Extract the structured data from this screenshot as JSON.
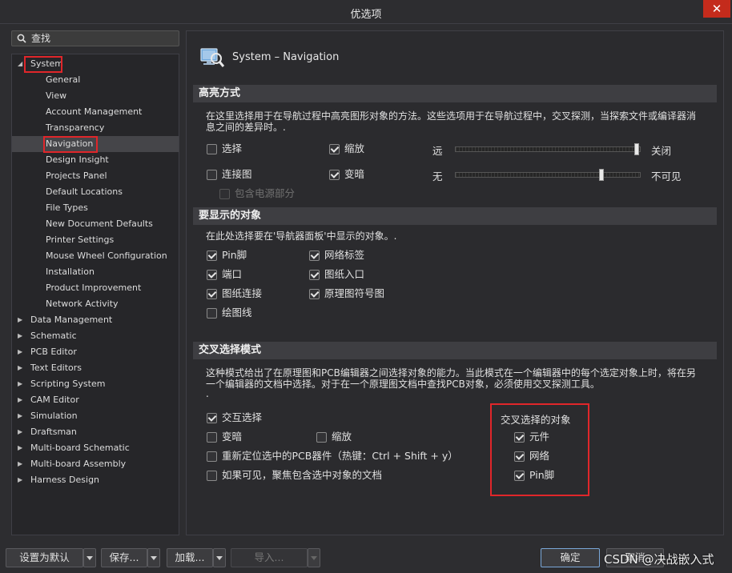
{
  "window": {
    "title": "优选项",
    "close_glyph": "✕"
  },
  "search": {
    "placeholder": "查找"
  },
  "tree": {
    "system": "System",
    "system_children": [
      "General",
      "View",
      "Account Management",
      "Transparency",
      "Navigation",
      "Design Insight",
      "Projects Panel",
      "Default Locations",
      "File Types",
      "New Document Defaults",
      "Printer Settings",
      "Mouse Wheel Configuration",
      "Installation",
      "Product Improvement",
      "Network Activity"
    ],
    "selected": "Navigation",
    "others": [
      "Data Management",
      "Schematic",
      "PCB Editor",
      "Text Editors",
      "Scripting System",
      "CAM Editor",
      "Simulation",
      "Draftsman",
      "Multi-board Schematic",
      "Multi-board Assembly",
      "Harness Design"
    ]
  },
  "page": {
    "title": "System – Navigation"
  },
  "highlight": {
    "title": "高亮方式",
    "desc": "在这里选择用于在导航过程中高亮图形对象的方法。这些选项用于在导航过程中，交叉探测，当探索文件或编译器消息之间的差异时。.",
    "cb_select": "选择",
    "cb_select_checked": false,
    "cb_zoom": "缩放",
    "cb_zoom_checked": true,
    "cb_connect": "连接图",
    "cb_connect_checked": false,
    "cb_dim": "变暗",
    "cb_dim_checked": true,
    "cb_power": "包含电源部分",
    "cb_power_checked": false,
    "slider1_left": "远",
    "slider1_right": "关闭",
    "slider1_value": 1.0,
    "slider2_left": "无",
    "slider2_right": "不可见",
    "slider2_value": 0.8
  },
  "objects": {
    "title": "要显示的对象",
    "desc": "在此处选择要在'导航器面板'中显示的对象。.",
    "items": [
      {
        "label": "Pin脚",
        "checked": true
      },
      {
        "label": "网络标签",
        "checked": true
      },
      {
        "label": "端口",
        "checked": true
      },
      {
        "label": "图纸入口",
        "checked": true
      },
      {
        "label": "图纸连接",
        "checked": true
      },
      {
        "label": "原理图符号图",
        "checked": true
      },
      {
        "label": "绘图线",
        "checked": false
      }
    ]
  },
  "cross": {
    "title": "交叉选择模式",
    "desc": "这种模式给出了在原理图和PCB编辑器之间选择对象的能力。当此模式在一个编辑器中的每个选定对象上时，将在另一个编辑器的文档中选择。对于在一个原理图文档中查找PCB对象，必须使用交叉探测工具。",
    "desc_tail": ".",
    "cb_cross": "交互选择",
    "cb_cross_checked": true,
    "cb_dim": "变暗",
    "cb_dim_checked": false,
    "cb_zoom": "缩放",
    "cb_zoom_checked": false,
    "cb_reposition": "重新定位选中的PCB器件（热键：Ctrl + Shift + y）",
    "cb_reposition_checked": false,
    "cb_focus": "如果可见，聚焦包含选中对象的文档",
    "cb_focus_checked": false,
    "group_title": "交叉选择的对象",
    "obj_component": "元件",
    "obj_component_checked": true,
    "obj_net": "网络",
    "obj_net_checked": true,
    "obj_pin": "Pin脚",
    "obj_pin_checked": true
  },
  "buttons": {
    "defaults": "设置为默认",
    "save": "保存...",
    "load": "加载...",
    "import": "导入...",
    "ok": "确定",
    "cancel": "取消"
  },
  "watermark": "CSDN @决战嵌入式",
  "colors": {
    "highlight_box": "#e0262a",
    "close_button": "#c42b1c"
  }
}
